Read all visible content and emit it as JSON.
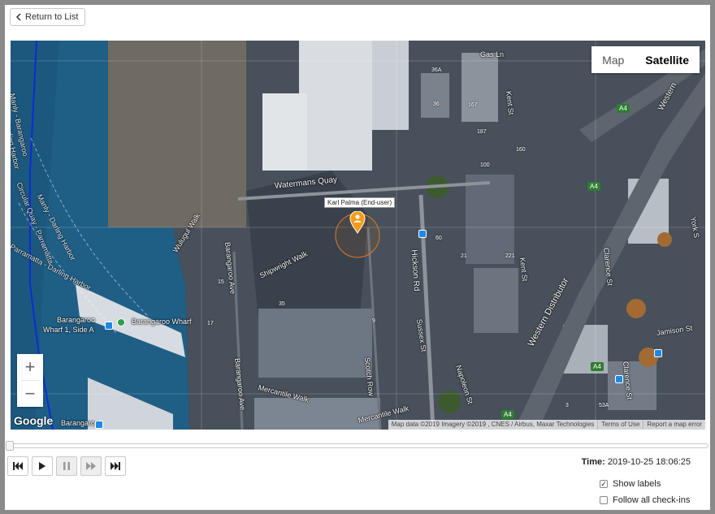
{
  "toolbar": {
    "return_label": "Return to List"
  },
  "map": {
    "type_control": {
      "map_label": "Map",
      "satellite_label": "Satellite",
      "active": "Satellite"
    },
    "zoom_in_label": "+",
    "zoom_out_label": "−",
    "google_logo": "Google",
    "attribution": {
      "data": "Map data ©2019 Imagery ©2019 , CNES / Airbus, Maxar Technologies",
      "terms": "Terms of Use",
      "report": "Report a map error"
    },
    "marker_label": "Karl Palma (End-user)",
    "labels": {
      "watermans_quay": "Watermans Quay",
      "hickson_rd": "Hickson Rd",
      "barangaroo_ave": "Barangaroo Ave",
      "shipwright_walk": "Shipwright Walk",
      "scotch_row": "Scotch Row",
      "sussex_st": "Sussex St",
      "napoleon_st": "Napoleon St",
      "western_distributor": "Western Distributor",
      "kent_st": "Kent St",
      "clarence_st": "Clarence St",
      "jamison_st": "Jamison St",
      "mercantile_walk_1": "Mercantile Walk",
      "mercantile_walk_2": "Mercantile Walk",
      "wulugul_walk": "Wulugul Walk",
      "barangaroo_wharf": "Barangaroo Wharf",
      "barangaroo_wharf_1": "Barangaroo",
      "barangaroo_wharf_2": "Wharf 1, Side A",
      "gas_ln": "Gas Ln",
      "western_top": "Western",
      "york_s": "York S",
      "ferry_1": "Manly - Barangaroo",
      "ferry_2": "Darling Harbor",
      "ferry_3": "Circular Quay - Parramatta",
      "ferry_4": "Manly - Darling Harbor",
      "ferry_5": "Parramatta - Darling Harbor",
      "barangaroo_bottom": "Barangaroo",
      "a4_1": "A4",
      "a4_2": "A4",
      "a4_3": "A4",
      "a4_4": "A4",
      "n36a": "36A",
      "n36": "36",
      "n167": "167",
      "n187": "187",
      "n160": "160",
      "n100": "100",
      "n221": "221",
      "n60": "60",
      "n21": "21",
      "n15": "15",
      "n17": "17",
      "n35": "35",
      "n53a": "53A",
      "n3": "3",
      "n9": "9"
    }
  },
  "playback": {
    "buttons": [
      "skip-back",
      "play",
      "pause",
      "fast-forward",
      "skip-forward"
    ],
    "disabled": [
      "pause",
      "fast-forward"
    ]
  },
  "status": {
    "time_label": "Time:",
    "time_value": "2019-10-25 18:06:25"
  },
  "options": {
    "show_labels": {
      "label": "Show labels",
      "checked": true
    },
    "follow_checkins": {
      "label": "Follow all check-ins",
      "checked": false
    }
  }
}
